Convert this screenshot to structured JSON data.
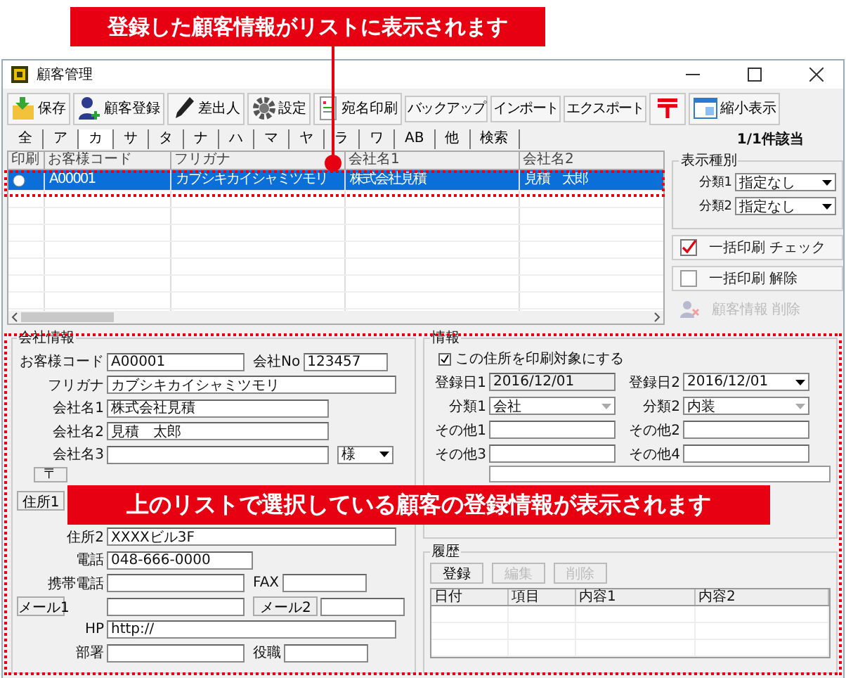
{
  "annotations": [
    {
      "kind": "top",
      "text": "登録した顧客情報がリストに表示されます"
    },
    {
      "kind": "bottom",
      "text": "上のリストで選択している顧客の登録情報が表示されます"
    }
  ],
  "window": {
    "title": "顧客管理"
  },
  "toolbar": [
    {
      "kind": "save",
      "label": "保存"
    },
    {
      "kind": "register",
      "label": "顧客登録"
    },
    {
      "kind": "sender",
      "label": "差出人"
    },
    {
      "kind": "settings",
      "label": "設定"
    },
    {
      "kind": "label",
      "label": "宛名印刷"
    },
    {
      "kind": "small",
      "label": "バックアップ"
    },
    {
      "kind": "small",
      "label": "インポート"
    },
    {
      "kind": "small",
      "label": "エクスポート"
    },
    {
      "kind": "post"
    },
    {
      "kind": "compact",
      "label": "縮小表示"
    }
  ],
  "kana_tabs": [
    {
      "label": "全",
      "selected": false
    },
    {
      "label": "ア",
      "selected": false
    },
    {
      "label": "カ",
      "selected": true
    },
    {
      "label": "サ",
      "selected": false
    },
    {
      "label": "タ",
      "selected": false
    },
    {
      "label": "ナ",
      "selected": false
    },
    {
      "label": "ハ",
      "selected": false
    },
    {
      "label": "マ",
      "selected": false
    },
    {
      "label": "ヤ",
      "selected": false
    },
    {
      "label": "ラ",
      "selected": false
    },
    {
      "label": "ワ",
      "selected": false
    },
    {
      "label": "AB",
      "selected": false
    },
    {
      "label": "他",
      "selected": false
    },
    {
      "label": "検索",
      "selected": false
    }
  ],
  "match_count": "1/1件該当",
  "list": {
    "columns": [
      "印刷",
      "お客様コード",
      "フリガナ",
      "会社名1",
      "会社名2"
    ],
    "rows": [
      {
        "selected": true,
        "marked": true,
        "cells": [
          "",
          "A00001",
          "カブシキカイシャミツモリ",
          "株式会社見積",
          "見積　太郎"
        ]
      }
    ]
  },
  "display_filter": {
    "title": "表示種別",
    "fields": [
      {
        "label": "分類1",
        "value": "指定なし"
      },
      {
        "label": "分類2",
        "value": "指定なし"
      }
    ]
  },
  "side_buttons": [
    {
      "kind": "check",
      "label": "一括印刷 チェック",
      "disabled": false
    },
    {
      "kind": "uncheck",
      "label": "一括印刷 解除",
      "disabled": false
    },
    {
      "kind": "delete",
      "label": "顧客情報 削除",
      "disabled": true
    }
  ],
  "company": {
    "title": "会社情報",
    "rows": [
      {
        "kind": "pair",
        "fields": [
          {
            "kind": "text",
            "label": "お客様コード",
            "value": "A00001"
          },
          {
            "kind": "text",
            "label": "会社No",
            "value": "123457"
          }
        ]
      },
      {
        "kind": "wide",
        "fields": [
          {
            "kind": "text",
            "label": "フリガナ",
            "value": "カブシキカイシャミツモリ"
          }
        ]
      },
      {
        "kind": "medium",
        "fields": [
          {
            "kind": "text",
            "label": "会社名1",
            "value": "株式会社見積"
          }
        ]
      },
      {
        "kind": "medium",
        "fields": [
          {
            "kind": "text",
            "label": "会社名2",
            "value": "見積　太郎"
          }
        ]
      },
      {
        "kind": "with_select",
        "fields": [
          {
            "kind": "text",
            "label": "会社名3"
          },
          {
            "kind": "select",
            "value": "様"
          }
        ]
      },
      {
        "kind": "postal",
        "fields": [
          {
            "kind": "button",
            "label": "〒"
          }
        ]
      },
      {
        "kind": "button_only",
        "fields": [
          {
            "kind": "button",
            "label": "住所1"
          }
        ]
      },
      {
        "kind": "wide",
        "fields": [
          {
            "kind": "text",
            "label": "住所2",
            "value": "XXXXビル3F"
          }
        ]
      },
      {
        "kind": "short",
        "fields": [
          {
            "kind": "text",
            "label": "電話",
            "value": "048-666-0000"
          }
        ]
      },
      {
        "kind": "pair",
        "fields": [
          {
            "kind": "text",
            "label": "携帯電話"
          },
          {
            "kind": "text",
            "label": "FAX"
          }
        ]
      },
      {
        "kind": "pair",
        "fields": [
          {
            "kind": "button",
            "label": "メール1"
          },
          {
            "kind": "button",
            "label": "メール2"
          }
        ]
      },
      {
        "kind": "wide",
        "fields": [
          {
            "kind": "text",
            "label": "HP",
            "value": "http://"
          }
        ]
      },
      {
        "kind": "pair",
        "fields": [
          {
            "kind": "text",
            "label": "部署"
          },
          {
            "kind": "text",
            "label": "役職"
          }
        ]
      }
    ]
  },
  "info": {
    "title": "情報",
    "print_target": {
      "label": "この住所を印刷対象にする",
      "checked": true
    },
    "rows": [
      [
        {
          "kind": "readonly",
          "label": "登録日1",
          "value": "2016/12/01"
        },
        {
          "kind": "select",
          "label": "登録日2",
          "value": "2016/12/01"
        }
      ],
      [
        {
          "kind": "select_off",
          "label": "分類1",
          "value": "会社"
        },
        {
          "kind": "select_off",
          "label": "分類2",
          "value": "内装"
        }
      ],
      [
        {
          "kind": "text",
          "label": "その他1"
        },
        {
          "kind": "text",
          "label": "その他2"
        }
      ],
      [
        {
          "kind": "text",
          "label": "その他3"
        },
        {
          "kind": "text",
          "label": "その他4"
        }
      ]
    ]
  },
  "history": {
    "title": "履歴",
    "buttons": [
      {
        "label": "登録",
        "disabled": false
      },
      {
        "label": "編集",
        "disabled": true
      },
      {
        "label": "削除",
        "disabled": true
      }
    ],
    "columns": [
      "日付",
      "項目",
      "内容1",
      "内容2"
    ]
  }
}
